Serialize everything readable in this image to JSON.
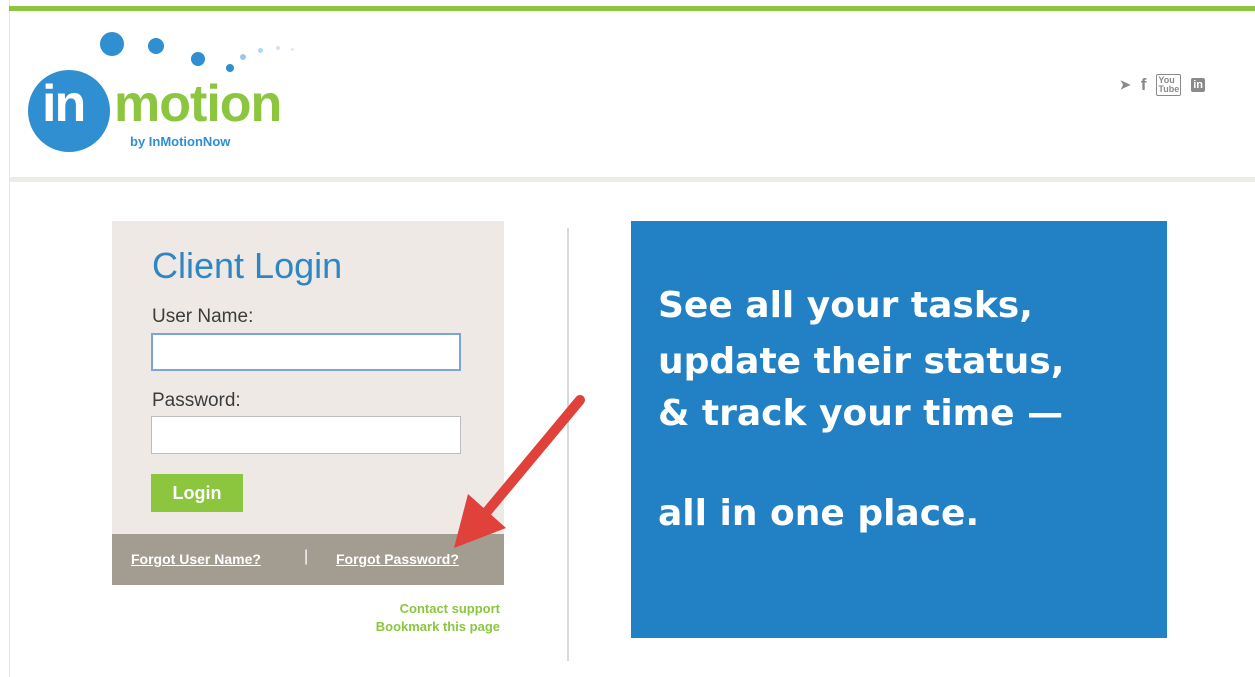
{
  "brand": {
    "logo_in": "in",
    "logo_motion": "motion",
    "logo_byline": "by InMotionNow"
  },
  "social": {
    "icons": [
      "twitter-icon",
      "facebook-icon",
      "youtube-icon",
      "linkedin-icon"
    ],
    "twitter": "➤",
    "facebook": "f",
    "youtube": "You\nTube",
    "linkedin": "in"
  },
  "login": {
    "title": "Client Login",
    "username_label": "User Name:",
    "username_value": "",
    "password_label": "Password:",
    "password_value": "",
    "login_button": "Login",
    "forgot_username": "Forgot User Name?",
    "separator": "|",
    "forgot_password": "Forgot Password?",
    "contact_support": "Contact support",
    "bookmark": "Bookmark this page"
  },
  "promo": {
    "line1": "See all your tasks,",
    "line2": "update their status,",
    "line3": "& track your time —",
    "line4": "all in one place."
  },
  "colors": {
    "brand_green": "#8cc63f",
    "brand_blue": "#2f8fd0",
    "promo_blue": "#2280c5",
    "arrow_red": "#e0413a"
  }
}
